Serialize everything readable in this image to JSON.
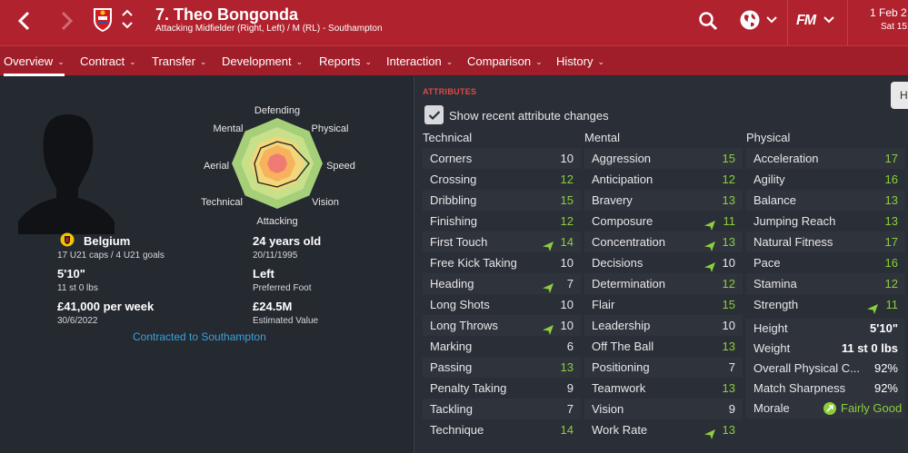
{
  "header": {
    "player_title": "7. Theo Bongonda",
    "player_subtitle": "Attacking Midfielder (Right, Left) / M (RL) - Southampton",
    "fm_logo": "FM",
    "date": "1 Feb 2",
    "day_time": "Sat 15:"
  },
  "nav": {
    "tabs": [
      "Overview",
      "Contract",
      "Transfer",
      "Development",
      "Reports",
      "Interaction",
      "Comparison",
      "History"
    ]
  },
  "profile": {
    "radar_labels": {
      "top": "Defending",
      "top_right": "Physical",
      "right": "Speed",
      "bottom_right": "Vision",
      "bottom": "Attacking",
      "bottom_left": "Technical",
      "left": "Aerial",
      "top_left": "Mental"
    },
    "nationality": "Belgium",
    "caps": "17 U21 caps / 4 U21 goals",
    "height": "5'10\"",
    "weight": "11 st 0 lbs",
    "wage": "£41,000 per week",
    "contract_end": "30/6/2022",
    "age": "24 years old",
    "dob": "20/11/1995",
    "foot": "Left",
    "foot_label": "Preferred Foot",
    "value": "£24.5M",
    "value_label": "Estimated Value",
    "contract_status": "Contracted to Southampton"
  },
  "attributes": {
    "section_title": "ATTRIBUTES",
    "toggle_label": "Show recent attribute changes",
    "side_button": "H",
    "technical_title": "Technical",
    "mental_title": "Mental",
    "physical_title": "Physical",
    "technical": [
      {
        "name": "Corners",
        "value": "10",
        "up": false
      },
      {
        "name": "Crossing",
        "value": "12",
        "up": false
      },
      {
        "name": "Dribbling",
        "value": "15",
        "up": false
      },
      {
        "name": "Finishing",
        "value": "12",
        "up": false
      },
      {
        "name": "First Touch",
        "value": "14",
        "up": true
      },
      {
        "name": "Free Kick Taking",
        "value": "10",
        "up": false
      },
      {
        "name": "Heading",
        "value": "7",
        "up": true
      },
      {
        "name": "Long Shots",
        "value": "10",
        "up": false
      },
      {
        "name": "Long Throws",
        "value": "10",
        "up": true
      },
      {
        "name": "Marking",
        "value": "6",
        "up": false
      },
      {
        "name": "Passing",
        "value": "13",
        "up": false
      },
      {
        "name": "Penalty Taking",
        "value": "9",
        "up": false
      },
      {
        "name": "Tackling",
        "value": "7",
        "up": false
      },
      {
        "name": "Technique",
        "value": "14",
        "up": false
      }
    ],
    "mental": [
      {
        "name": "Aggression",
        "value": "15",
        "up": false
      },
      {
        "name": "Anticipation",
        "value": "12",
        "up": false
      },
      {
        "name": "Bravery",
        "value": "13",
        "up": false
      },
      {
        "name": "Composure",
        "value": "11",
        "up": true
      },
      {
        "name": "Concentration",
        "value": "13",
        "up": true
      },
      {
        "name": "Decisions",
        "value": "10",
        "up": true
      },
      {
        "name": "Determination",
        "value": "12",
        "up": false
      },
      {
        "name": "Flair",
        "value": "15",
        "up": false
      },
      {
        "name": "Leadership",
        "value": "10",
        "up": false
      },
      {
        "name": "Off The Ball",
        "value": "13",
        "up": false
      },
      {
        "name": "Positioning",
        "value": "7",
        "up": false
      },
      {
        "name": "Teamwork",
        "value": "13",
        "up": false
      },
      {
        "name": "Vision",
        "value": "9",
        "up": false
      },
      {
        "name": "Work Rate",
        "value": "13",
        "up": true
      }
    ],
    "physical": [
      {
        "name": "Acceleration",
        "value": "17",
        "up": false
      },
      {
        "name": "Agility",
        "value": "16",
        "up": false
      },
      {
        "name": "Balance",
        "value": "13",
        "up": false
      },
      {
        "name": "Jumping Reach",
        "value": "13",
        "up": false
      },
      {
        "name": "Natural Fitness",
        "value": "17",
        "up": false
      },
      {
        "name": "Pace",
        "value": "16",
        "up": false
      },
      {
        "name": "Stamina",
        "value": "12",
        "up": false
      },
      {
        "name": "Strength",
        "value": "11",
        "up": true
      }
    ],
    "info": [
      {
        "label": "Height",
        "value": "5'10\""
      },
      {
        "label": "Weight",
        "value": "11 st 0 lbs"
      },
      {
        "label": "Overall Physical C...",
        "value": "92%"
      },
      {
        "label": "Match Sharpness",
        "value": "92%"
      }
    ],
    "morale_label": "Morale",
    "morale_value": "Fairly Good"
  },
  "colors": {
    "header_red": "#b1222f",
    "nav_red": "#9f1e2a",
    "value_high": "#8ccf3c",
    "value_normal": "#e8e8e8",
    "link_blue": "#3aa2dd",
    "section_red": "#e04a4a"
  }
}
